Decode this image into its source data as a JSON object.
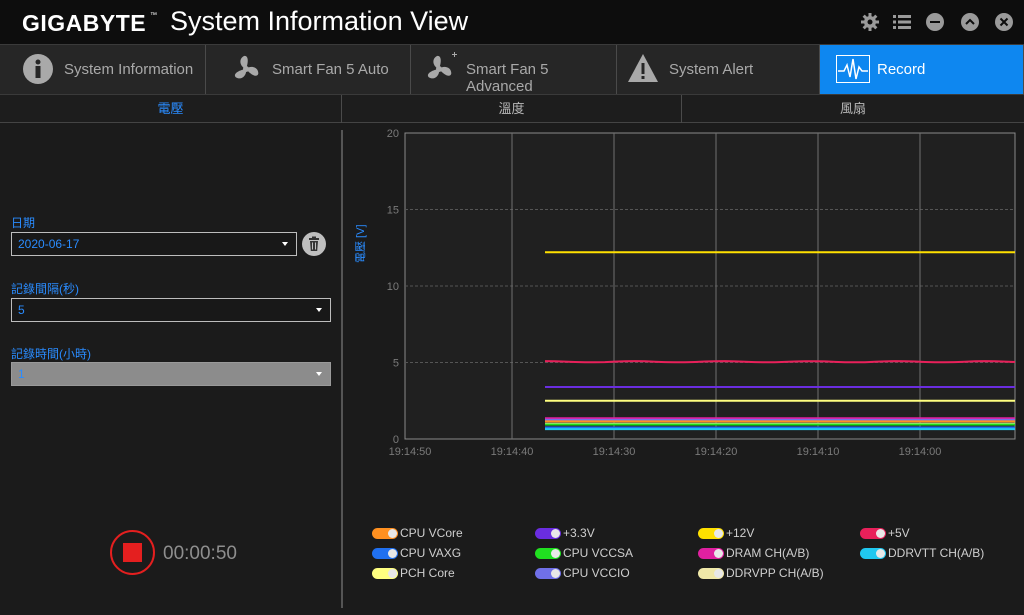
{
  "titlebar": {
    "brand": "GIGABYTE",
    "brand_tm": "™",
    "title": "System Information View",
    "icons": [
      "gear-icon",
      "list-icon",
      "minimize-icon",
      "collapse-icon",
      "close-icon"
    ]
  },
  "main_tabs": [
    {
      "label": "System Information",
      "icon": "info-icon"
    },
    {
      "label": "Smart Fan 5 Auto",
      "icon": "fan-icon"
    },
    {
      "label": "Smart Fan 5 Advanced",
      "icon": "fan-plus-icon"
    },
    {
      "label": "System Alert",
      "icon": "warning-icon"
    },
    {
      "label": "Record",
      "icon": "waveform-icon",
      "active": true
    }
  ],
  "sub_tabs": [
    {
      "label": "電壓",
      "active": true
    },
    {
      "label": "溫度"
    },
    {
      "label": "風扇"
    }
  ],
  "left_panel": {
    "date_label": "日期",
    "date_value": "2020-06-17",
    "interval_label": "記錄間隔(秒)",
    "interval_value": "5",
    "duration_label": "記錄時間(小時)",
    "duration_value": "1",
    "timer": "00:00:50"
  },
  "chart_data": {
    "type": "line",
    "ylabel": "電壓 [V]",
    "xlabel": "",
    "ylim": [
      0,
      20
    ],
    "yticks": [
      "0",
      "5",
      "10",
      "15",
      "20"
    ],
    "xticks": [
      "19:14:50",
      "19:14:40",
      "19:14:30",
      "19:14:20",
      "19:14:10",
      "19:14:00"
    ],
    "grid": true,
    "series": [
      {
        "name": "+12V",
        "color": "#ffe000",
        "value": 12.2
      },
      {
        "name": "+5V",
        "color": "#e8205a",
        "value": 5.05
      },
      {
        "name": "+3.3V",
        "color": "#6a2de0",
        "value": 3.4
      },
      {
        "name": "PCH Core",
        "color": "#ffff80",
        "value": 2.5
      },
      {
        "name": "DRAM CH(A/B)",
        "color": "#e020a0",
        "value": 1.35
      },
      {
        "name": "CPU VCCIO",
        "color": "#7070e8",
        "value": 1.25
      },
      {
        "name": "CPU VCore",
        "color": "#ff9020",
        "value": 1.15
      },
      {
        "name": "DDRVPP CH(A/B)",
        "color": "#f0e8a8",
        "value": 1.0
      },
      {
        "name": "CPU VCCSA",
        "color": "#20e020",
        "value": 0.95
      },
      {
        "name": "CPU VAXG",
        "color": "#2070f0",
        "value": 0.75
      },
      {
        "name": "DDRVTT CH(A/B)",
        "color": "#20c8f0",
        "value": 0.65
      }
    ]
  },
  "legend": [
    {
      "name": "CPU VCore",
      "color": "#ff9020"
    },
    {
      "name": "+3.3V",
      "color": "#6a2de0"
    },
    {
      "name": "+12V",
      "color": "#ffe000"
    },
    {
      "name": "+5V",
      "color": "#e8205a"
    },
    {
      "name": "CPU VAXG",
      "color": "#2070f0"
    },
    {
      "name": "CPU VCCSA",
      "color": "#20e020"
    },
    {
      "name": "DRAM CH(A/B)",
      "color": "#e020a0"
    },
    {
      "name": "DDRVTT CH(A/B)",
      "color": "#20c8f0"
    },
    {
      "name": "PCH Core",
      "color": "#ffff80"
    },
    {
      "name": "CPU VCCIO",
      "color": "#7070e8"
    },
    {
      "name": "DDRVPP CH(A/B)",
      "color": "#f0e8a8"
    }
  ]
}
